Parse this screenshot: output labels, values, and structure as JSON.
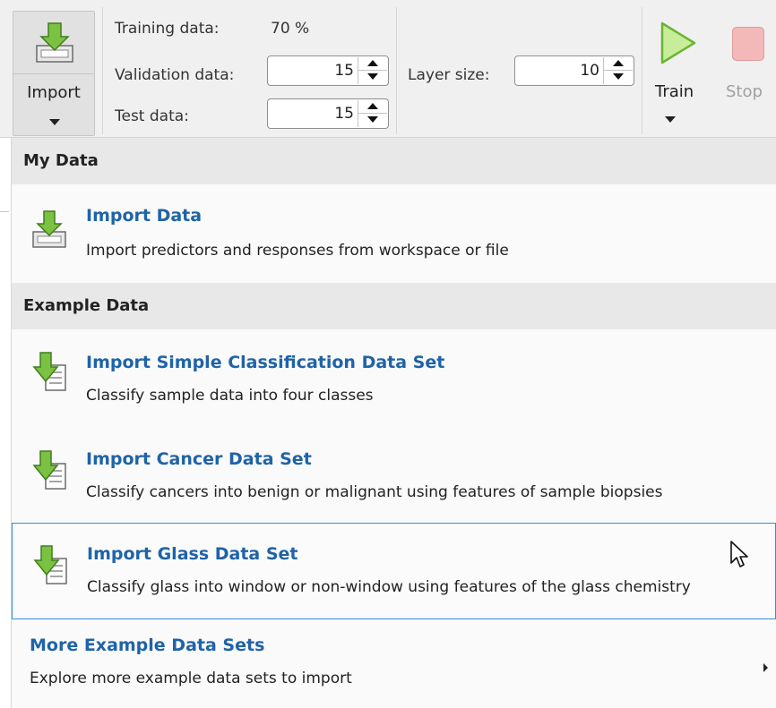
{
  "toolbar": {
    "import_label": "Import",
    "training_label": "Training data:",
    "training_value": "70 %",
    "validation_label": "Validation data:",
    "validation_value": "15",
    "test_label": "Test data:",
    "test_value": "15",
    "layer_label": "Layer size:",
    "layer_value": "10",
    "train_label": "Train",
    "stop_label": "Stop"
  },
  "menu": {
    "my_data_header": "My Data",
    "example_header": "Example Data",
    "items": [
      {
        "title": "Import Data",
        "desc": "Import predictors and responses from workspace or file",
        "icon": "import-data-icon"
      },
      {
        "title": "Import Simple Classification Data Set",
        "desc": "Classify sample data into four classes",
        "icon": "import-dataset-icon"
      },
      {
        "title": "Import Cancer Data Set",
        "desc": "Classify cancers into benign or malignant using features of sample biopsies",
        "icon": "import-dataset-icon"
      },
      {
        "title": "Import Glass Data Set",
        "desc": "Classify glass into window or non-window using features of the glass chemistry",
        "icon": "import-dataset-icon"
      },
      {
        "title": "More Example Data Sets",
        "desc": "Explore more example data sets to import",
        "icon": "chevron-right-icon"
      }
    ]
  },
  "colors": {
    "link": "#1f63a8",
    "accent_green": "#7cc242",
    "hover_border": "#3a8ed0",
    "stop_red": "#f3b8b8"
  }
}
